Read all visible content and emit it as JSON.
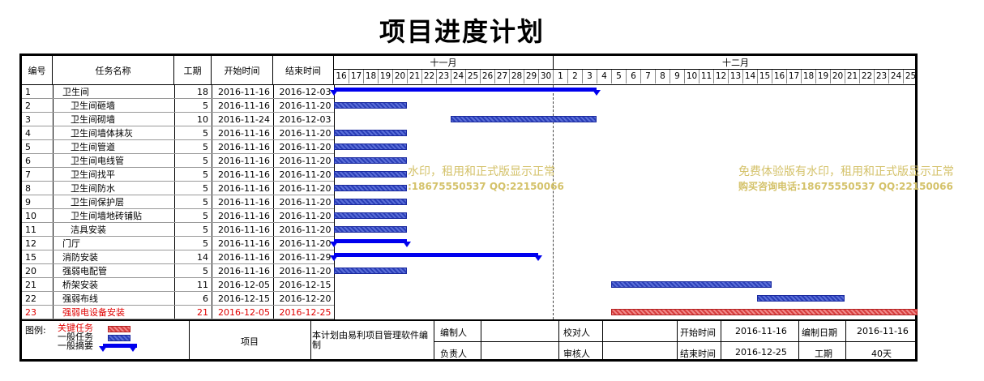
{
  "title": "项目进度计划",
  "columns": {
    "id": "编号",
    "name": "任务名称",
    "dur": "工期",
    "start": "开始时间",
    "end": "结束时间"
  },
  "months": [
    {
      "label": "十一月",
      "first_day": 0,
      "days": 15
    },
    {
      "label": "十二月",
      "first_day": 15,
      "days": 25
    }
  ],
  "days": [
    "16",
    "17",
    "18",
    "19",
    "20",
    "21",
    "22",
    "23",
    "24",
    "25",
    "26",
    "27",
    "28",
    "29",
    "30",
    "1",
    "2",
    "3",
    "4",
    "5",
    "6",
    "7",
    "8",
    "9",
    "10",
    "11",
    "12",
    "13",
    "14",
    "15",
    "16",
    "17",
    "18",
    "19",
    "20",
    "21",
    "22",
    "23",
    "24",
    "25"
  ],
  "today_marker_day_index": 15,
  "rows": [
    {
      "id": "1",
      "name": "卫生间",
      "dur": "18",
      "start": "2016-11-16",
      "end": "2016-12-03",
      "type": "summary",
      "level": 0,
      "bar_start_day": 0,
      "bar_days": 18
    },
    {
      "id": "2",
      "name": "卫生间砸墙",
      "dur": "5",
      "start": "2016-11-16",
      "end": "2016-11-20",
      "type": "normal",
      "level": 1,
      "bar_start_day": 0,
      "bar_days": 5
    },
    {
      "id": "3",
      "name": "卫生间砌墙",
      "dur": "10",
      "start": "2016-11-24",
      "end": "2016-12-03",
      "type": "normal",
      "level": 1,
      "bar_start_day": 8,
      "bar_days": 10
    },
    {
      "id": "4",
      "name": "卫生间墙体抹灰",
      "dur": "5",
      "start": "2016-11-16",
      "end": "2016-11-20",
      "type": "normal",
      "level": 1,
      "bar_start_day": 0,
      "bar_days": 5
    },
    {
      "id": "5",
      "name": "卫生间管道",
      "dur": "5",
      "start": "2016-11-16",
      "end": "2016-11-20",
      "type": "normal",
      "level": 1,
      "bar_start_day": 0,
      "bar_days": 5
    },
    {
      "id": "6",
      "name": "卫生间电线管",
      "dur": "5",
      "start": "2016-11-16",
      "end": "2016-11-20",
      "type": "normal",
      "level": 1,
      "bar_start_day": 0,
      "bar_days": 5
    },
    {
      "id": "7",
      "name": "卫生间找平",
      "dur": "5",
      "start": "2016-11-16",
      "end": "2016-11-20",
      "type": "normal",
      "level": 1,
      "bar_start_day": 0,
      "bar_days": 5
    },
    {
      "id": "8",
      "name": "卫生间防水",
      "dur": "5",
      "start": "2016-11-16",
      "end": "2016-11-20",
      "type": "normal",
      "level": 1,
      "bar_start_day": 0,
      "bar_days": 5
    },
    {
      "id": "9",
      "name": "卫生间保护层",
      "dur": "5",
      "start": "2016-11-16",
      "end": "2016-11-20",
      "type": "normal",
      "level": 1,
      "bar_start_day": 0,
      "bar_days": 5
    },
    {
      "id": "10",
      "name": "卫生间墙地砖铺贴",
      "dur": "5",
      "start": "2016-11-16",
      "end": "2016-11-20",
      "type": "normal",
      "level": 1,
      "bar_start_day": 0,
      "bar_days": 5
    },
    {
      "id": "11",
      "name": "洁具安装",
      "dur": "5",
      "start": "2016-11-16",
      "end": "2016-11-20",
      "type": "normal",
      "level": 1,
      "bar_start_day": 0,
      "bar_days": 5
    },
    {
      "id": "12",
      "name": "门厅",
      "dur": "5",
      "start": "2016-11-16",
      "end": "2016-11-20",
      "type": "summary",
      "level": 0,
      "bar_start_day": 0,
      "bar_days": 5
    },
    {
      "id": "15",
      "name": "消防安装",
      "dur": "14",
      "start": "2016-11-16",
      "end": "2016-11-29",
      "type": "summary",
      "level": 0,
      "bar_start_day": 0,
      "bar_days": 14
    },
    {
      "id": "20",
      "name": "强弱电配管",
      "dur": "5",
      "start": "2016-11-16",
      "end": "2016-11-20",
      "type": "normal",
      "level": 0,
      "bar_start_day": 0,
      "bar_days": 5
    },
    {
      "id": "21",
      "name": "桥架安装",
      "dur": "11",
      "start": "2016-12-05",
      "end": "2016-12-15",
      "type": "normal",
      "level": 0,
      "bar_start_day": 19,
      "bar_days": 11
    },
    {
      "id": "22",
      "name": "强弱布线",
      "dur": "6",
      "start": "2016-12-15",
      "end": "2016-12-20",
      "type": "normal",
      "level": 0,
      "bar_start_day": 29,
      "bar_days": 6
    },
    {
      "id": "23",
      "name": "强弱电设备安装",
      "dur": "21",
      "start": "2016-12-05",
      "end": "2016-12-25",
      "type": "critical",
      "level": 0,
      "bar_start_day": 19,
      "bar_days": 21
    }
  ],
  "watermark": {
    "line1": "免费体验版有水印，租用和正式版显示正常",
    "line2": "购买咨询电话:18675550537 QQ:22150066",
    "line1_partial": "水印，租用和正式版显示正常",
    "line2_partial": ":18675550537 QQ:22150066"
  },
  "footer": {
    "legend_label": "图例:",
    "legend_critical": "关键任务",
    "legend_normal": "一般任务",
    "legend_summary": "一般摘要",
    "project_label": "项目",
    "software_note": "本计划由易利项目管理软件编制",
    "editor_label": "编制人",
    "reviewer_label": "校对人",
    "start_label": "开始时间",
    "start_value": "2016-11-16",
    "edit_date_label": "编制日期",
    "edit_date_value": "2016-11-16",
    "owner_label": "负责人",
    "auditor_label": "审核人",
    "end_label": "结束时间",
    "end_value": "2016-12-25",
    "duration_label": "工期",
    "duration_value": "40天"
  },
  "colors": {
    "summary": "#0000ee",
    "normal": "#3a4fc8",
    "critical": "#e05050",
    "critical_text": "#e00000",
    "watermark": "#d4c26a"
  }
}
